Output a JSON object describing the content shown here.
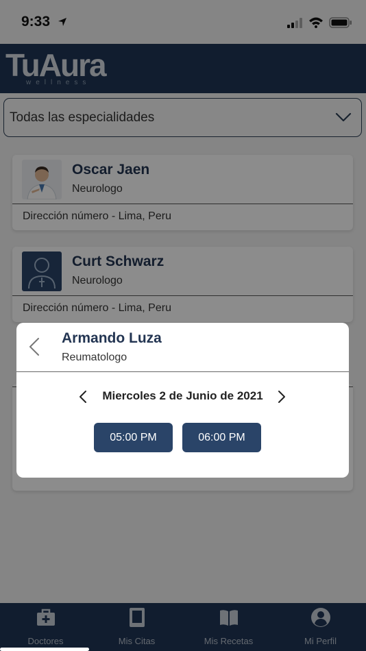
{
  "status": {
    "time": "9:33"
  },
  "header": {
    "logo": "TuAura",
    "logo_sub": "wellness"
  },
  "filter": {
    "label": "Todas las especialidades"
  },
  "doctors": [
    {
      "name": "Oscar Jaen",
      "specialty": "Neurologo",
      "address": "Dirección número - Lima, Peru"
    },
    {
      "name": "Curt Schwarz",
      "specialty": "Neurologo",
      "address": "Dirección número - Lima, Peru"
    }
  ],
  "modal": {
    "name": "Armando Luza",
    "specialty": "Reumatologo",
    "date": "Miercoles 2 de Junio de 2021",
    "slots": [
      "05:00 PM",
      "06:00 PM"
    ]
  },
  "tabs": [
    {
      "label": "Doctores"
    },
    {
      "label": "Mis Citas"
    },
    {
      "label": "Mis Recetas"
    },
    {
      "label": "Mi Perfil"
    }
  ],
  "colors": {
    "primary": "#1f3556",
    "button": "#2a4468",
    "name": "#233552"
  }
}
